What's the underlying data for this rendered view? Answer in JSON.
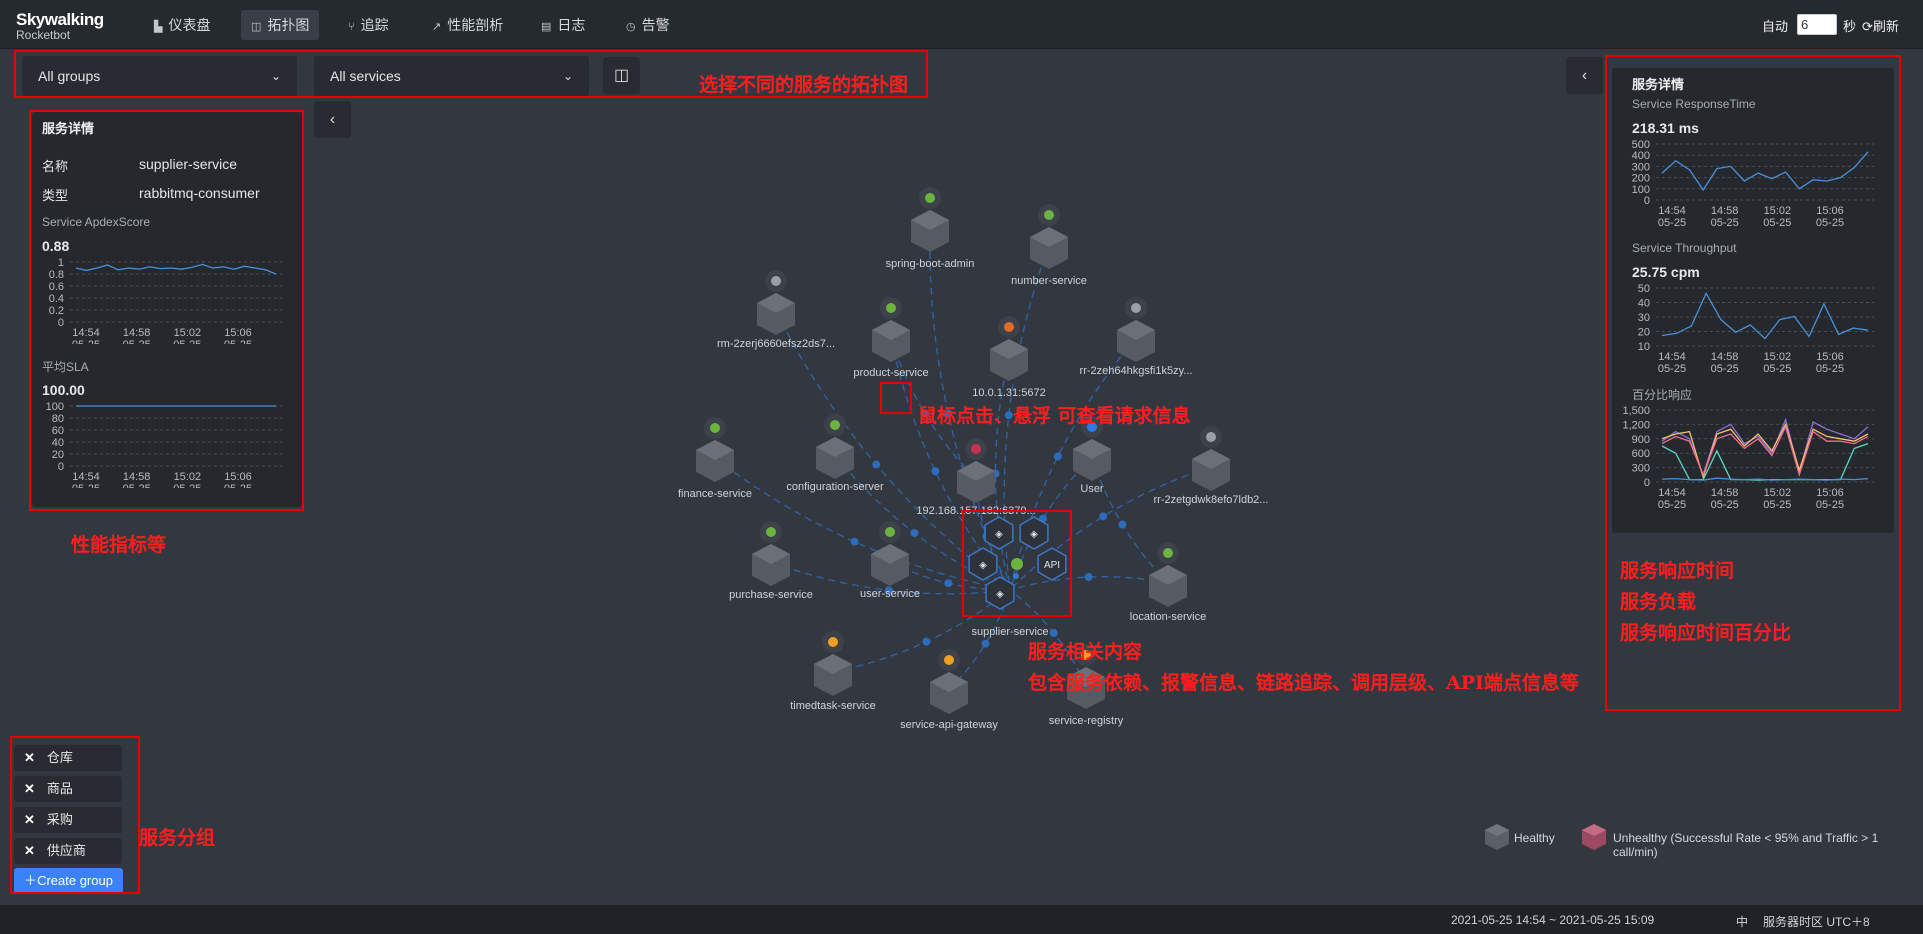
{
  "nav": {
    "logo_title": "Skywalking",
    "logo_subtitle": "Rocketbot",
    "items": [
      {
        "label": "仪表盘",
        "icon": "bar-chart-icon"
      },
      {
        "label": "拓扑图",
        "icon": "topology-icon",
        "active": true
      },
      {
        "label": "追踪",
        "icon": "trace-icon"
      },
      {
        "label": "性能剖析",
        "icon": "profile-icon"
      },
      {
        "label": "日志",
        "icon": "log-icon"
      },
      {
        "label": "告警",
        "icon": "alarm-icon"
      }
    ],
    "auto_label": "自动",
    "interval_value": "6",
    "seconds_label": "秒",
    "refresh_label": "刷新"
  },
  "filters": {
    "group_value": "All groups",
    "service_value": "All services"
  },
  "left_panel": {
    "title": "服务详情",
    "name_label": "名称",
    "name_value": "supplier-service",
    "type_label": "类型",
    "type_value": "rabbitmq-consumer",
    "apdex_label": "Service ApdexScore",
    "apdex_value": "0.88",
    "sla_label": "平均SLA",
    "sla_value": "100.00"
  },
  "right_panel": {
    "title": "服务详情",
    "resp_label": "Service ResponseTime",
    "resp_value": "218.31 ms",
    "throughput_label": "Service Throughput",
    "throughput_value": "25.75 cpm",
    "percentile_label": "百分比响应"
  },
  "chart_data": [
    {
      "type": "line",
      "id": "apdex",
      "x_ticks": [
        "14:54\n05-25",
        "14:58\n05-25",
        "15:02\n05-25",
        "15:06\n05-25"
      ],
      "y_ticks": [
        "1",
        "0.8",
        "0.6",
        "0.4",
        "0.2",
        "0"
      ],
      "ylim": [
        0,
        1
      ],
      "series": [
        {
          "values": [
            0.9,
            0.86,
            0.9,
            0.95,
            0.87,
            0.9,
            0.88,
            0.92,
            0.89,
            0.9,
            0.88,
            0.91,
            0.96,
            0.9,
            0.92,
            0.88,
            0.93,
            0.9,
            0.87,
            0.8
          ]
        }
      ],
      "color": "#4a90d9"
    },
    {
      "type": "line",
      "id": "sla",
      "x_ticks": [
        "14:54\n05-25",
        "14:58\n05-25",
        "15:02\n05-25",
        "15:06\n05-25"
      ],
      "y_ticks": [
        "100",
        "80",
        "60",
        "40",
        "20",
        "0"
      ],
      "ylim": [
        0,
        100
      ],
      "series": [
        {
          "values": [
            100,
            100,
            100,
            100,
            100,
            100,
            100,
            100,
            100,
            100,
            100,
            100,
            100,
            100,
            100,
            100,
            100,
            100,
            100,
            100
          ]
        }
      ],
      "color": "#4a90d9"
    },
    {
      "type": "line",
      "id": "response_time",
      "x_ticks": [
        "14:54\n05-25",
        "14:58\n05-25",
        "15:02\n05-25",
        "15:06\n05-25"
      ],
      "y_ticks": [
        "500",
        "400",
        "300",
        "200",
        "100",
        "0"
      ],
      "ylim": [
        0,
        500
      ],
      "series": [
        {
          "values": [
            240,
            350,
            270,
            90,
            280,
            300,
            170,
            240,
            190,
            250,
            100,
            180,
            170,
            200,
            290,
            430
          ]
        }
      ],
      "color": "#4a90d9"
    },
    {
      "type": "line",
      "id": "throughput",
      "x_ticks": [
        "14:54\n05-25",
        "14:58\n05-25",
        "15:02\n05-25",
        "15:06\n05-25"
      ],
      "y_ticks": [
        "50",
        "40",
        "30",
        "20",
        "10"
      ],
      "ylim": [
        5,
        60
      ],
      "series": [
        {
          "values": [
            15,
            17,
            24,
            55,
            30,
            18,
            25,
            12,
            30,
            33,
            14,
            45,
            16,
            22,
            20
          ]
        }
      ],
      "color": "#4a90d9"
    },
    {
      "type": "line",
      "id": "percentile",
      "x_ticks": [
        "14:54\n05-25",
        "14:58\n05-25",
        "15:02\n05-25",
        "15:06\n05-25"
      ],
      "y_ticks": [
        "1,500",
        "1,200",
        "900",
        "600",
        "300",
        "0"
      ],
      "ylim": [
        0,
        1500
      ],
      "series": [
        {
          "values": [
            850,
            1050,
            900,
            150,
            1050,
            1200,
            800,
            950,
            600,
            1300,
            200,
            1250,
            1100,
            1000,
            900,
            1150
          ],
          "color": "#8e6dd6"
        },
        {
          "values": [
            900,
            1000,
            1050,
            100,
            1000,
            1100,
            750,
            1000,
            650,
            1200,
            250,
            1100,
            950,
            900,
            850,
            1000
          ],
          "color": "#f2c36b"
        },
        {
          "values": [
            800,
            950,
            850,
            150,
            900,
            1000,
            700,
            900,
            550,
            1150,
            150,
            1050,
            850,
            850,
            800,
            950
          ],
          "color": "#ef6e8c"
        },
        {
          "values": [
            750,
            600,
            50,
            50,
            650,
            50,
            50,
            40,
            50,
            50,
            50,
            50,
            50,
            50,
            700,
            800
          ],
          "color": "#5ad8c0"
        },
        {
          "values": [
            60,
            70,
            50,
            40,
            80,
            60,
            50,
            60,
            40,
            50,
            60,
            50,
            40,
            60,
            50,
            70
          ],
          "color": "#4a90d9"
        }
      ]
    }
  ],
  "topology": {
    "nodes": [
      {
        "name": "spring-boot-admin",
        "icon": "spring-icon"
      },
      {
        "name": "number-service",
        "icon": "spring-icon"
      },
      {
        "name": "rm-2zerj6660efsz2ds7...",
        "icon": "database-icon"
      },
      {
        "name": "product-service",
        "icon": "spring-icon"
      },
      {
        "name": "10.0.1.31:5672",
        "icon": "rabbitmq-icon"
      },
      {
        "name": "rr-2zeh64hkgsfi1k5zy...",
        "icon": "database-icon"
      },
      {
        "name": "finance-service",
        "icon": "spring-icon"
      },
      {
        "name": "configuration-server",
        "icon": "spring-icon"
      },
      {
        "name": "192.168.157.182:6379...",
        "icon": "redis-icon"
      },
      {
        "name": "User",
        "icon": "user-icon"
      },
      {
        "name": "rr-2zetgdwk8efo7ldb2...",
        "icon": "database-icon"
      },
      {
        "name": "purchase-service",
        "icon": "spring-icon"
      },
      {
        "name": "user-service",
        "icon": "spring-icon"
      },
      {
        "name": "supplier-service",
        "icon": "spring-icon"
      },
      {
        "name": "location-service",
        "icon": "spring-icon"
      },
      {
        "name": "timedtask-service",
        "icon": "bird-icon"
      },
      {
        "name": "service-api-gateway",
        "icon": "bird-icon"
      },
      {
        "name": "service-registry",
        "icon": "bird-icon"
      }
    ],
    "hex_menu": [
      "dependency-icon",
      "layers-icon",
      "alarm-icon",
      "API",
      "trace-icon"
    ]
  },
  "groups": {
    "items": [
      "仓库",
      "商品",
      "采购",
      "供应商"
    ],
    "create_label": "Create group"
  },
  "legend": {
    "healthy": "Healthy",
    "unhealthy": "Unhealthy (Successful Rate < 95% and Traffic > 1 call/min)"
  },
  "footer": {
    "time_range": "2021-05-25 14:54 ~ 2021-05-25 15:09",
    "lang": "中",
    "timezone": "服务器时区 UTC＋8"
  },
  "annotations": {
    "topology_select": "选择不同的服务的拓扑图",
    "click_hover": "鼠标点击、悬浮 可查看请求信息",
    "perf_metrics": "性能指标等",
    "service_related": "服务相关内容",
    "service_related_detail": "包含服务依赖、报警信息、链路追踪、调用层级、API端点信息等",
    "resp_time": "服务响应时间",
    "load": "服务负载",
    "percentile": "服务响应时间百分比",
    "groups": "服务分组"
  },
  "colors": {
    "accent": "#3b82f6",
    "annotation": "#ff1e1e",
    "line": "#4a90d9"
  }
}
